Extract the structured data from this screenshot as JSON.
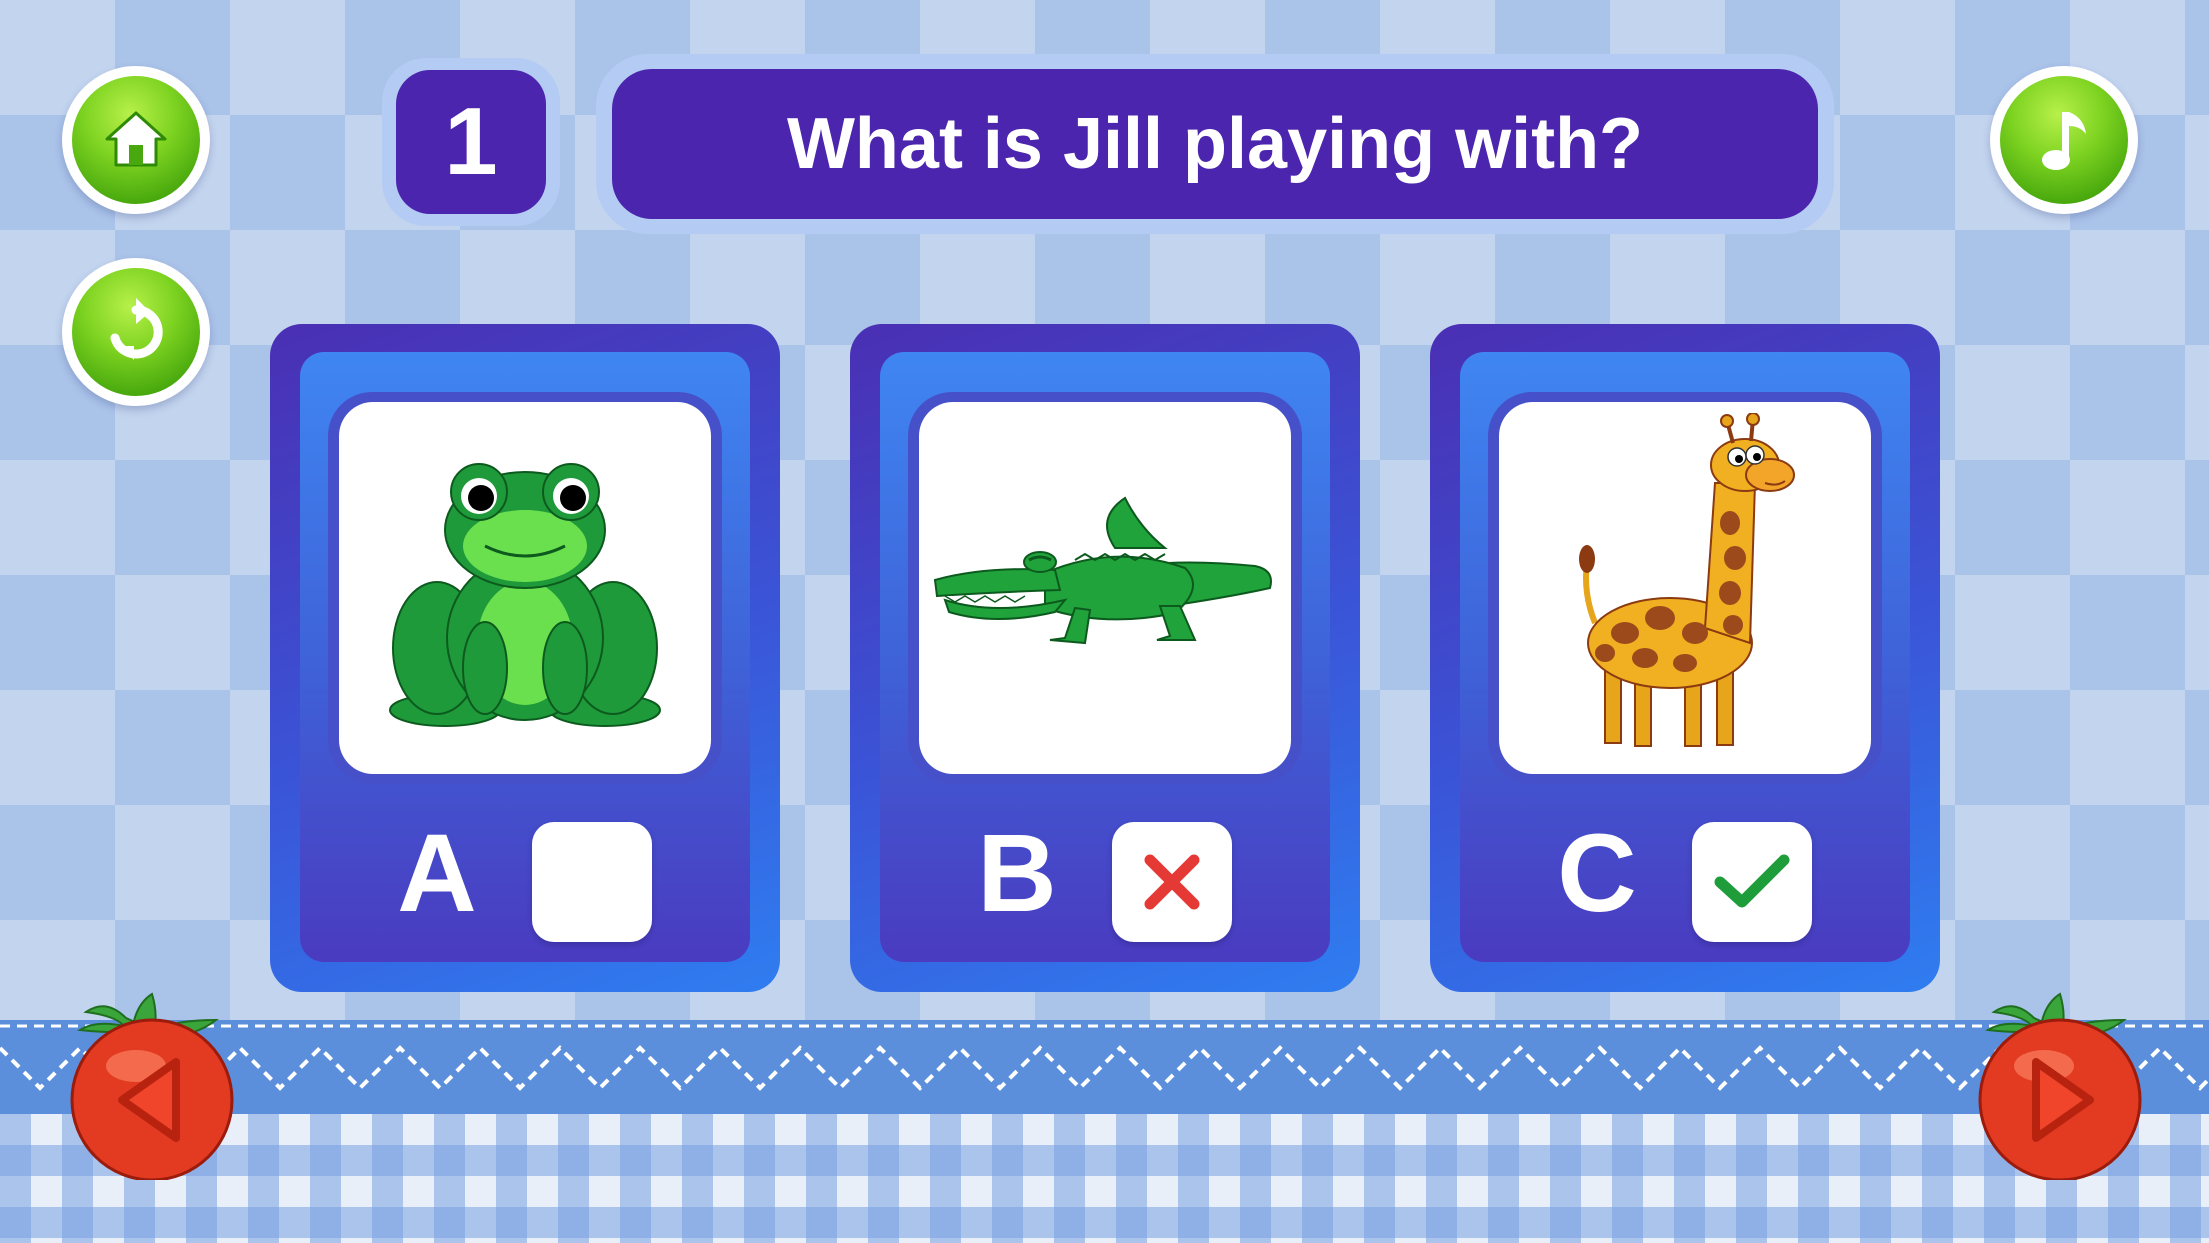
{
  "controls": {
    "home_icon": "home-icon",
    "replay_icon": "replay-icon",
    "music_icon": "music-note-icon",
    "prev_icon": "previous-arrow-icon",
    "next_icon": "next-arrow-icon"
  },
  "question": {
    "number": "1",
    "text": "What is Jill playing with?"
  },
  "options": [
    {
      "letter": "A",
      "picture": "frog",
      "state": "unselected"
    },
    {
      "letter": "B",
      "picture": "crocodile",
      "state": "wrong"
    },
    {
      "letter": "C",
      "picture": "giraffe",
      "state": "correct"
    }
  ],
  "colors": {
    "accent": "#4b25ad",
    "button_green": "#7ed321",
    "wrong_mark": "#e53935",
    "correct_mark": "#1f9d3a"
  }
}
